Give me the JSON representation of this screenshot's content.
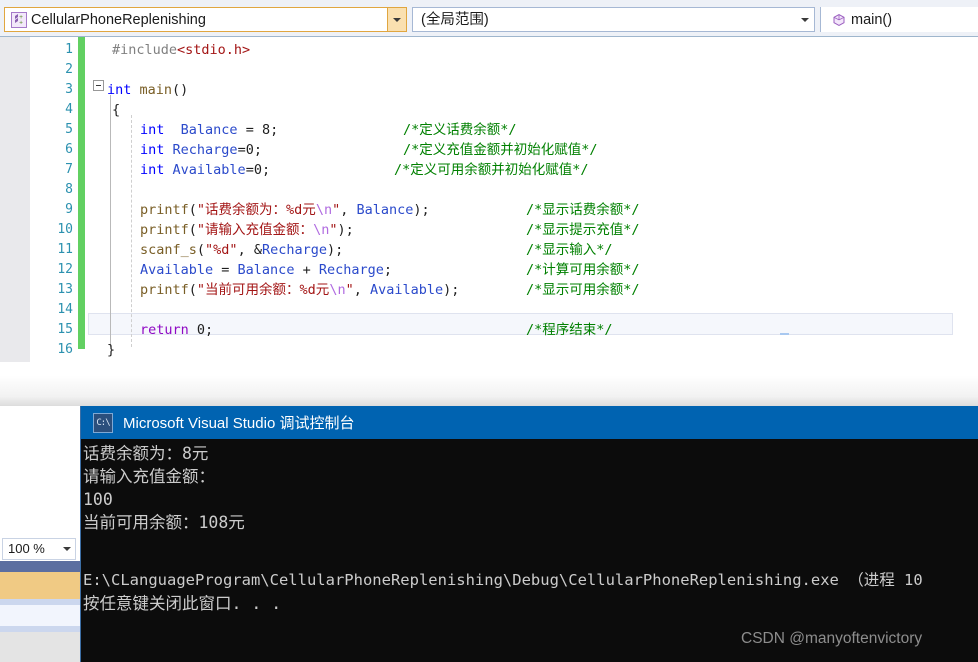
{
  "nav": {
    "project_combo": {
      "label": "CellularPhoneReplenishing",
      "icon": "cpp-project-icon",
      "arrow": "chevron-down-icon"
    },
    "scope_combo": {
      "label": "(全局范围)",
      "arrow": "chevron-down-icon"
    },
    "member_combo": {
      "label": "main()",
      "icon": "method-icon"
    }
  },
  "editor": {
    "line_numbers": [
      "1",
      "2",
      "3",
      "4",
      "5",
      "6",
      "7",
      "8",
      "9",
      "10",
      "11",
      "12",
      "13",
      "14",
      "15",
      "16"
    ],
    "lines": [
      {
        "n": "1",
        "code": "#include<stdio.h>",
        "comment": ""
      },
      {
        "n": "2",
        "code": "",
        "comment": ""
      },
      {
        "n": "3",
        "code": "int main()",
        "comment": ""
      },
      {
        "n": "4",
        "code": "{",
        "comment": ""
      },
      {
        "n": "5",
        "code": "    int  Balance = 8;",
        "comment": "/*定义话费余额*/"
      },
      {
        "n": "6",
        "code": "    int Recharge=0;",
        "comment": "/*定义充值金额并初始化赋值*/"
      },
      {
        "n": "7",
        "code": "    int Available=0;",
        "comment": "/*定义可用余额并初始化赋值*/"
      },
      {
        "n": "8",
        "code": "",
        "comment": ""
      },
      {
        "n": "9",
        "code": "    printf(\"话费余额为：%d元\\n\", Balance);",
        "comment": "/*显示话费余额*/"
      },
      {
        "n": "10",
        "code": "    printf(\"请输入充值金额：\\n\");",
        "comment": "/*显示提示充值*/"
      },
      {
        "n": "11",
        "code": "    scanf_s(\"%d\", &Recharge);",
        "comment": "/*显示输入*/"
      },
      {
        "n": "12",
        "code": "    Available = Balance + Recharge;",
        "comment": "/*计算可用余额*/"
      },
      {
        "n": "13",
        "code": "    printf(\"当前可用余额：%d元\\n\", Available);",
        "comment": "/*显示可用余额*/"
      },
      {
        "n": "14",
        "code": "",
        "comment": ""
      },
      {
        "n": "15",
        "code": "    return 0;",
        "comment": "/*程序结束*/"
      },
      {
        "n": "16",
        "code": "}",
        "comment": ""
      }
    ],
    "zoom": {
      "value": "100 %",
      "arrow": "chevron-down-icon"
    }
  },
  "console": {
    "title": "Microsoft Visual Studio 调试控制台",
    "icon_text": "C:\\",
    "output": [
      "话费余额为：8元",
      "请输入充值金额：",
      "100",
      "当前可用余额：108元",
      "",
      "E:\\CLanguageProgram\\CellularPhoneReplenishing\\Debug\\CellularPhoneReplenishing.exe （进程 10",
      "按任意键关闭此窗口. . ."
    ]
  },
  "watermark": {
    "text": "CSDN @manyoftenvictory"
  },
  "colors": {
    "keyword": "#0000ff",
    "control_keyword": "#8f08c4",
    "string": "#a31515",
    "comment": "#008000",
    "function": "#795e26",
    "preprocessor": "#808080",
    "line_number": "#2b91af",
    "change_bar": "#62d062",
    "console_titlebar": "#0063b1",
    "project_combo_border": "#e0a640"
  }
}
